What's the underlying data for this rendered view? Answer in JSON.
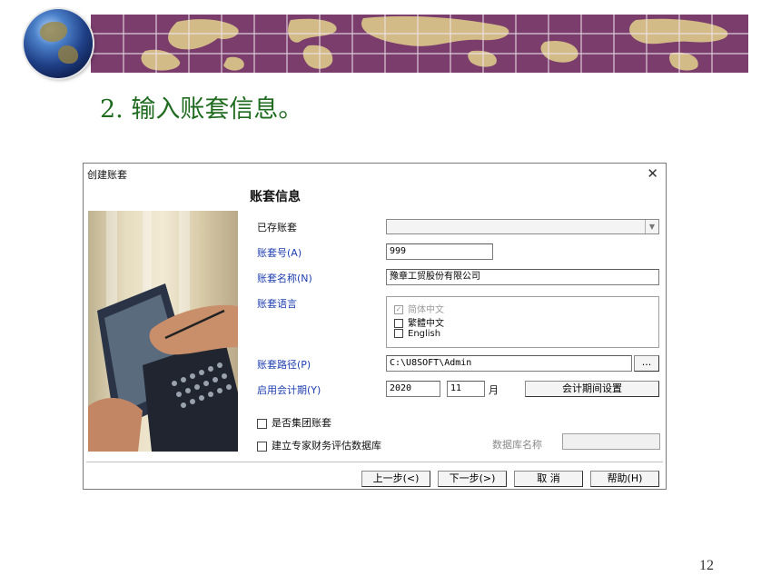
{
  "slide": {
    "title": "2. 输入账套信息。",
    "page_number": "12"
  },
  "dialog": {
    "title": "创建账套",
    "close_glyph": "✕",
    "section_title": "账套信息",
    "labels": {
      "existing": "已存账套",
      "number": "账套号(A)",
      "name": "账套名称(N)",
      "language": "账套语言",
      "path": "账套路径(P)",
      "start_period": "启用会计期(Y)",
      "month_unit": "月"
    },
    "fields": {
      "number": "999",
      "name": "豫章工贸股份有限公司",
      "path": "C:\\U8SOFT\\Admin",
      "year": "2020",
      "month": "11"
    },
    "languages": [
      {
        "label": "简体中文",
        "checked": true,
        "disabled": true
      },
      {
        "label": "繁體中文",
        "checked": false,
        "disabled": false
      },
      {
        "label": "English",
        "checked": false,
        "disabled": false
      }
    ],
    "browse_label": "...",
    "period_settings_label": "会计期间设置",
    "options": {
      "group_account": "是否集团账套",
      "expert_db": "建立专家财务评估数据库"
    },
    "db_name_label": "数据库名称",
    "buttons": {
      "prev": "上一步(<)",
      "next": "下一步(>)",
      "cancel": "取 消",
      "help": "帮助(H)"
    },
    "icons": {
      "dropdown": "chevron-down-icon",
      "close": "close-icon"
    }
  }
}
